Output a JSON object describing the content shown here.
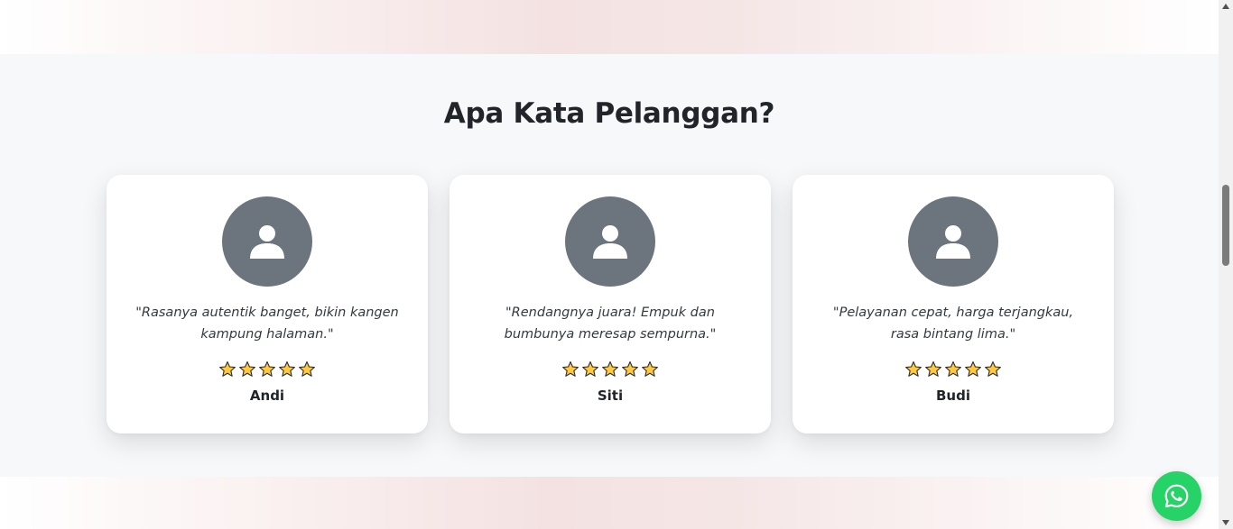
{
  "section": {
    "title": "Apa Kata Pelanggan?"
  },
  "testimonials": [
    {
      "quote": "\"Rasanya autentik banget, bikin kangen kampung halaman.\"",
      "name": "Andi",
      "rating": 5,
      "avatar_icon": "user-icon"
    },
    {
      "quote": "\"Rendangnya juara! Empuk dan bumbunya meresap sempurna.\"",
      "name": "Siti",
      "rating": 5,
      "avatar_icon": "user-icon"
    },
    {
      "quote": "\"Pelayanan cepat, harga terjangkau, rasa bintang lima.\"",
      "name": "Budi",
      "rating": 5,
      "avatar_icon": "user-icon"
    }
  ],
  "colors": {
    "avatar_bg": "#6c757d",
    "star_fill": "#ffc83d",
    "whatsapp": "#25d366",
    "section_bg": "#f7f8fa"
  },
  "floating": {
    "icon": "whatsapp-icon"
  }
}
